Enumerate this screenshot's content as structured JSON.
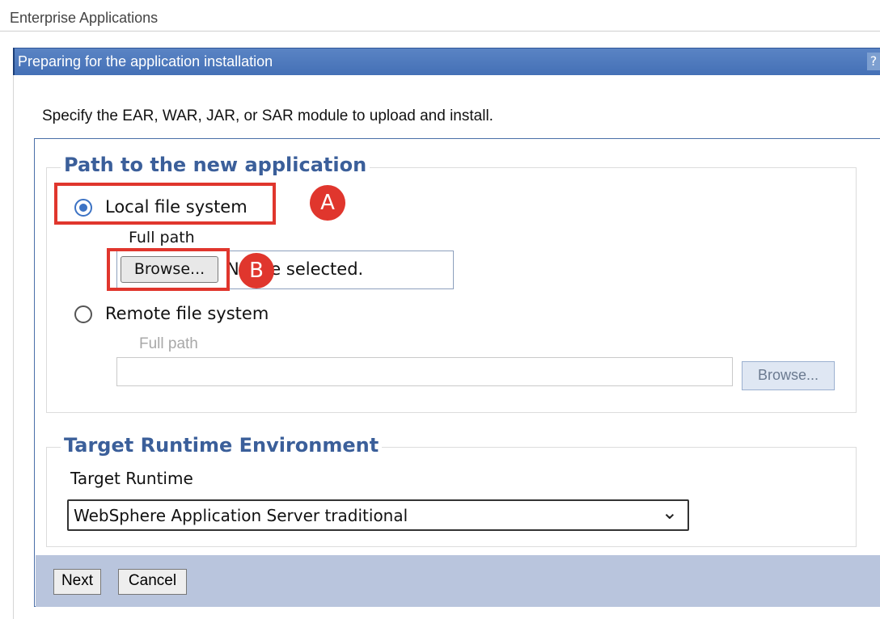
{
  "breadcrumb": "Enterprise Applications",
  "titlebar": {
    "title": "Preparing for the application installation",
    "help_glyph": "?"
  },
  "instructions": "Specify the EAR, WAR, JAR, or SAR module to upload and install.",
  "path_section": {
    "legend": "Path to the new application",
    "local": {
      "label": "Local file system",
      "checked": true,
      "field_label": "Full path",
      "browse_label": "Browse...",
      "file_status": "No file selected."
    },
    "remote": {
      "label": "Remote file system",
      "checked": false,
      "field_label": "Full path",
      "value": "",
      "browse_label": "Browse..."
    }
  },
  "runtime_section": {
    "legend": "Target Runtime Environment",
    "label": "Target Runtime",
    "selected": "WebSphere Application Server traditional",
    "chevron": "⌄"
  },
  "footer": {
    "next_label": "Next",
    "cancel_label": "Cancel"
  },
  "callouts": {
    "a": "A",
    "b": "B",
    "color": "#e0362d"
  },
  "colors": {
    "titlebar": "#4a76bc",
    "legend": "#3b5f9a",
    "footer": "#b9c5dd",
    "radio_selected": "#3d73c4"
  }
}
